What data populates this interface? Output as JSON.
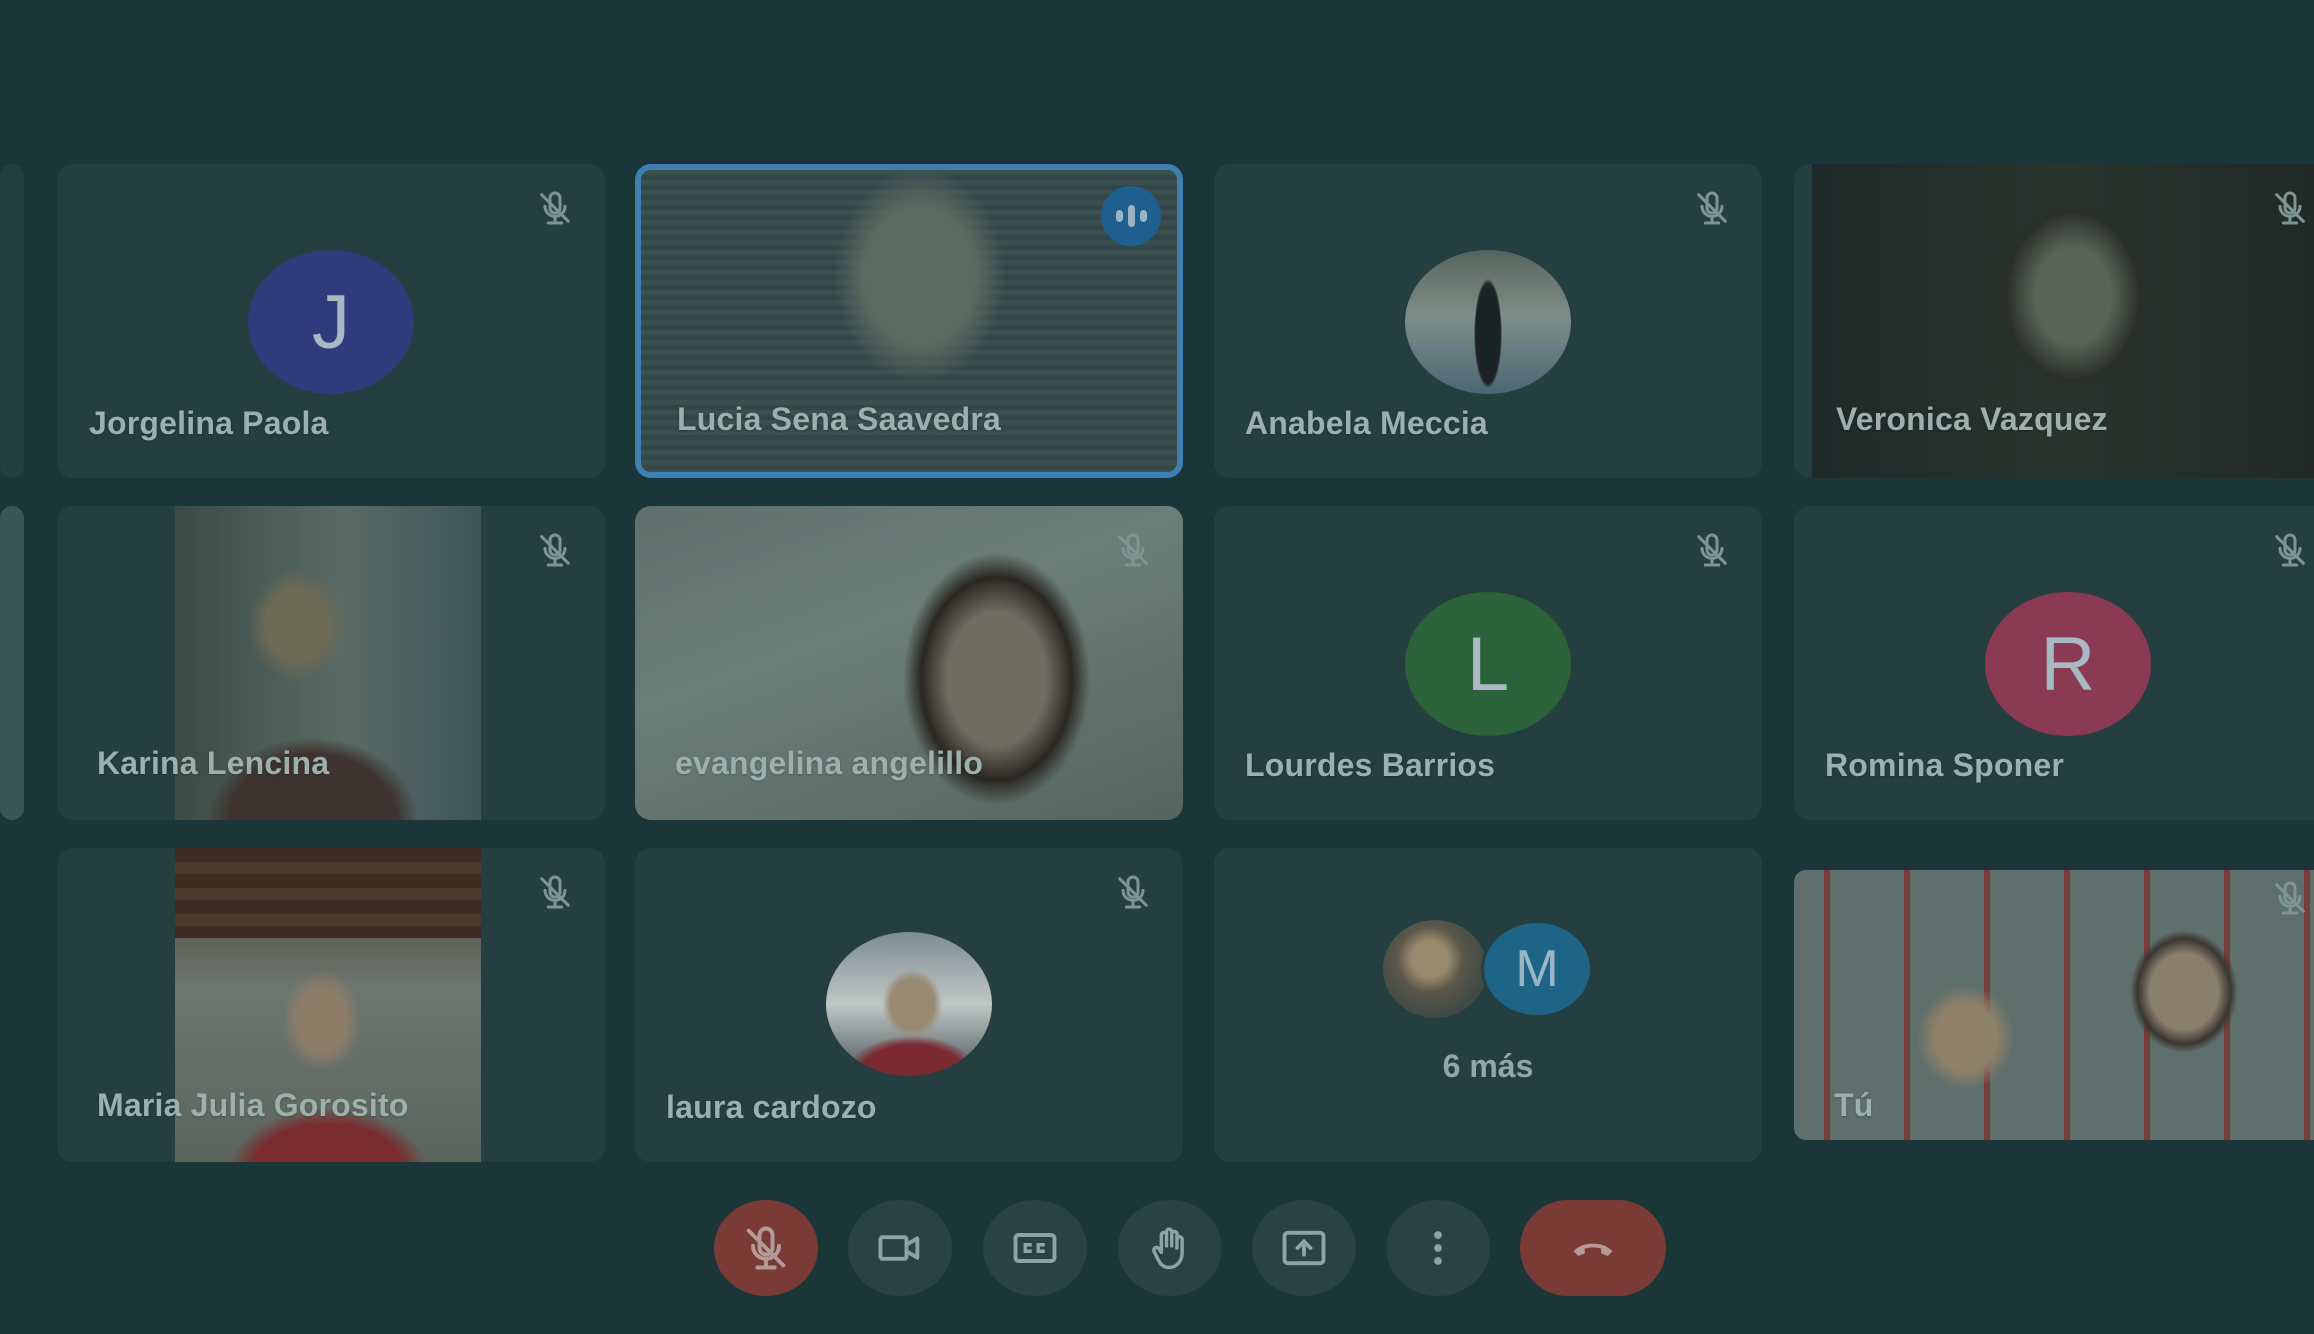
{
  "participants": [
    {
      "name": "Jorgelina Paola",
      "initial": "J",
      "color": "#2f3b7a",
      "type": "letter"
    },
    {
      "name": "Lucia Sena Saavedra",
      "type": "video",
      "speaking": true
    },
    {
      "name": "Anabela Meccia",
      "type": "photo"
    },
    {
      "name": "Veronica Vazquez",
      "type": "video"
    },
    {
      "name": "Karina Lencina",
      "type": "video"
    },
    {
      "name": "evangelina angelillo",
      "type": "video"
    },
    {
      "name": "Lourdes Barrios",
      "initial": "L",
      "color": "#2a6239",
      "type": "letter"
    },
    {
      "name": "Romina Sponer",
      "initial": "R",
      "color": "#8a3a52",
      "type": "letter"
    },
    {
      "name": "Maria Julia Gorosito",
      "type": "video"
    },
    {
      "name": "laura cardozo",
      "type": "photo"
    },
    {
      "name": "Tú",
      "type": "video"
    }
  ],
  "overflow": {
    "label": "6 más",
    "initial": "M"
  },
  "controls": [
    {
      "icon": "mic-off-icon",
      "state": "off"
    },
    {
      "icon": "camera-icon"
    },
    {
      "icon": "captions-icon"
    },
    {
      "icon": "raise-hand-icon"
    },
    {
      "icon": "present-screen-icon"
    },
    {
      "icon": "more-options-icon"
    },
    {
      "icon": "leave-call-icon"
    }
  ],
  "colors": {
    "background": "#1b3638",
    "tile": "#253f41",
    "active_border": "#3f7fb2",
    "end_call": "#7a3a36"
  }
}
